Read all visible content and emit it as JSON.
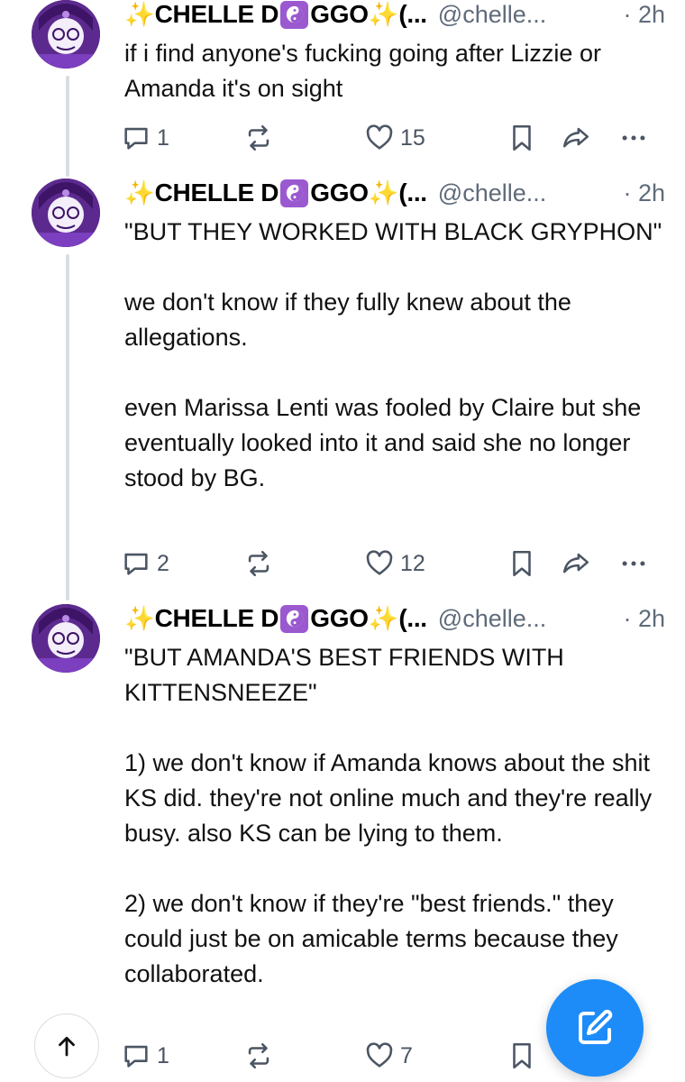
{
  "posts": [
    {
      "sparkle_left": "✨",
      "name_part1": "CHELLE D",
      "name_part2": "GGO",
      "sparkle_right": "✨",
      "name_suffix": "(...",
      "handle": "@chelle...",
      "time": "· 2h",
      "text": "if i find anyone's fucking going after Lizzie or Amanda it's on sight",
      "reply_count": "1",
      "repost_count": "",
      "like_count": "15"
    },
    {
      "sparkle_left": "✨",
      "name_part1": "CHELLE D",
      "name_part2": "GGO",
      "sparkle_right": "✨",
      "name_suffix": "(...",
      "handle": "@chelle...",
      "time": "· 2h",
      "text": "\"BUT THEY WORKED WITH BLACK GRYPHON\"\n\nwe don't know if they fully knew about the allegations.\n\neven Marissa Lenti was fooled by Claire but she eventually looked into it and said she no longer stood by BG.",
      "reply_count": "2",
      "repost_count": "",
      "like_count": "12"
    },
    {
      "sparkle_left": "✨",
      "name_part1": "CHELLE D",
      "name_part2": "GGO",
      "sparkle_right": "✨",
      "name_suffix": "(...",
      "handle": "@chelle...",
      "time": "· 2h",
      "text": "\"BUT AMANDA'S BEST FRIENDS WITH KITTENSNEEZE\"\n\n1) we don't know if Amanda knows about the shit KS did. they're not online much and they're really busy. also KS can be lying to them.\n\n2) we don't know if they're \"best friends.\" they could just be on amicable terms because they collaborated.",
      "reply_count": "1",
      "repost_count": "",
      "like_count": "7"
    }
  ],
  "icons": {
    "reply": "reply-icon",
    "repost": "repost-icon",
    "like": "heart-icon",
    "bookmark": "bookmark-icon",
    "share": "share-icon",
    "more": "more-icon",
    "scroll_top": "arrow-up-icon",
    "compose": "compose-icon",
    "yin_yang": "yin-yang-icon"
  },
  "colors": {
    "accent": "#1d8cf8",
    "muted": "#5f6b7a",
    "thread_line": "#d9dde3",
    "avatar_purple": "#5c2a8e",
    "yin_tile": "#9b59d0",
    "sparkle": "#f2c94c"
  }
}
